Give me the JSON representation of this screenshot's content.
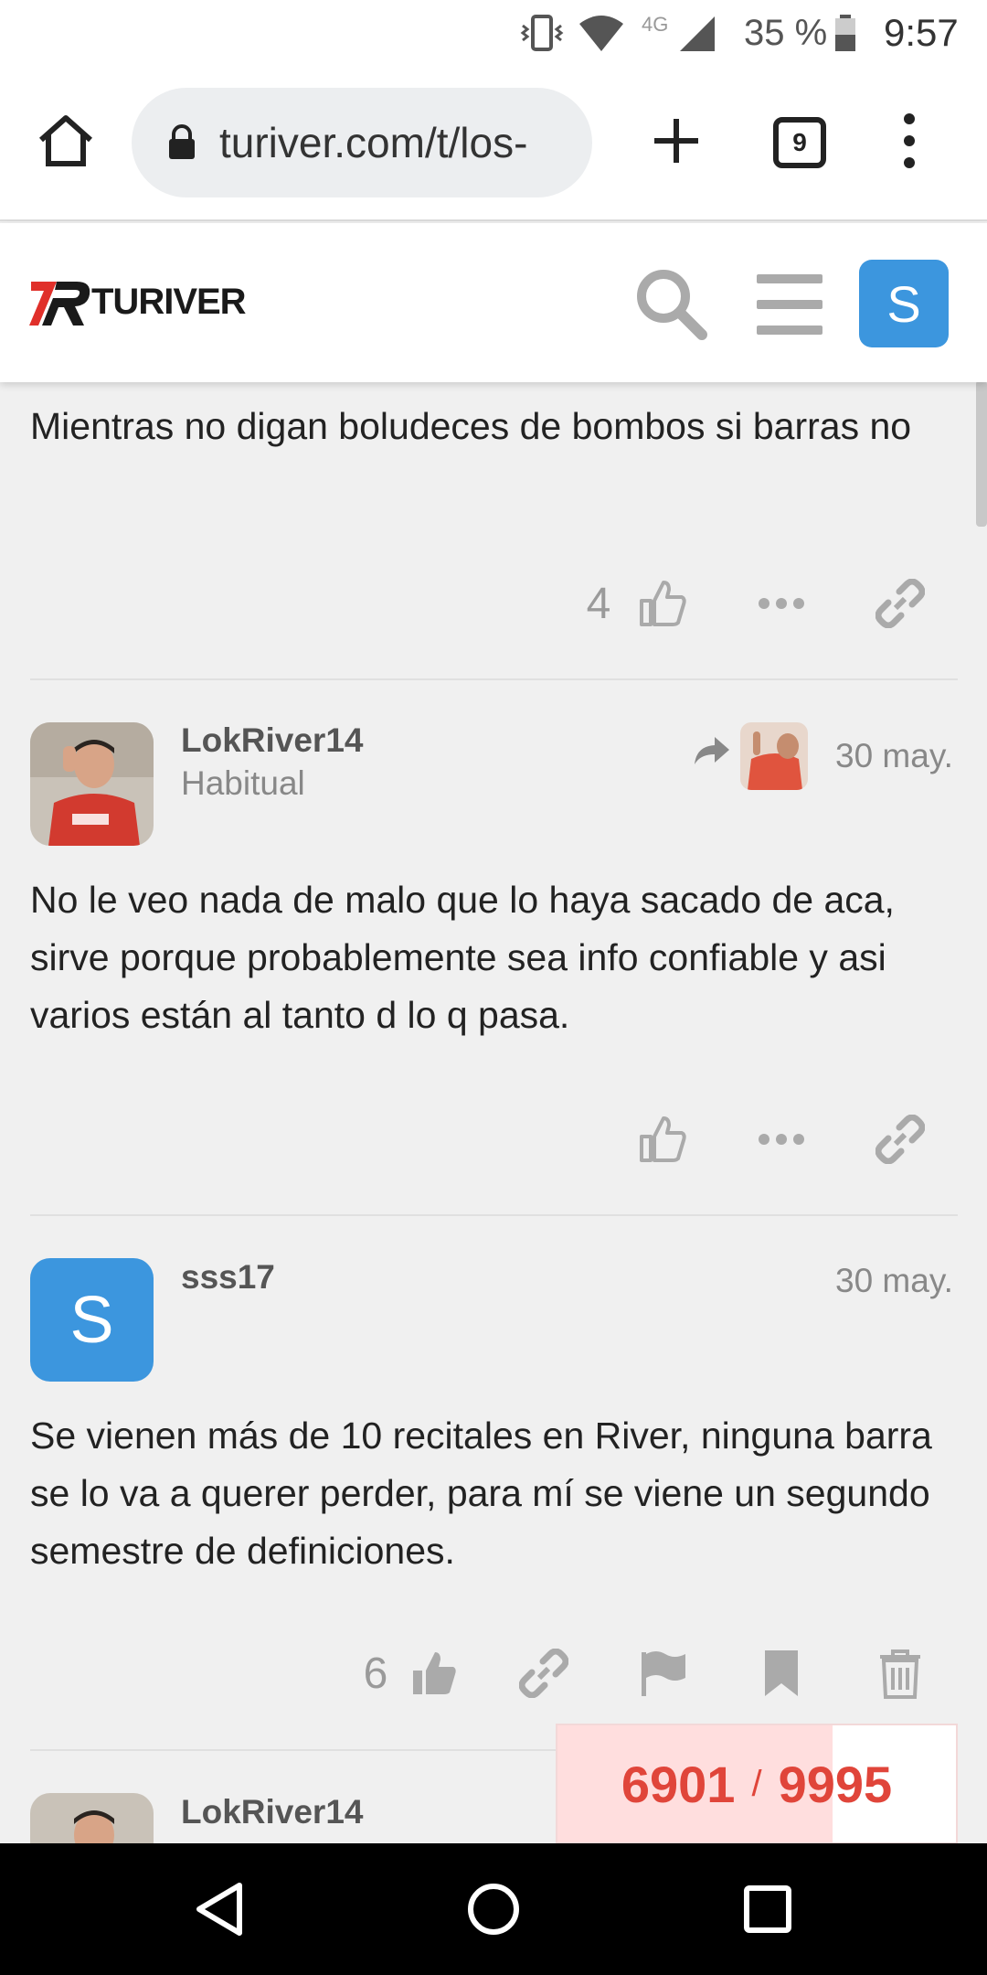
{
  "status_bar": {
    "battery": "35 %",
    "network": "4G",
    "time": "9:57"
  },
  "browser": {
    "url": "turiver.com/t/los-",
    "tab_count": "9"
  },
  "site": {
    "logo_text": "TURIVER",
    "user_avatar_letter": "S"
  },
  "posts": [
    {
      "text": "Mientras no digan boludeces de bombos si barras no",
      "like_count": "4"
    },
    {
      "username": "LokRiver14",
      "user_title": "Habitual",
      "date": "30 may.",
      "text": "No le veo nada de malo que lo haya sacado de aca, sirve porque probablemente sea info confiable y asi varios están al tanto d lo q pasa."
    },
    {
      "username": "sss17",
      "avatar_letter": "S",
      "date": "30 may.",
      "text": "Se vienen más de 10 recitales en River, ninguna barra se lo va a querer perder, para mí se viene un segundo semestre de definiciones.",
      "like_count": "6"
    },
    {
      "username": "LokRiver14"
    }
  ],
  "progress": {
    "current": "6901",
    "separator": "/",
    "total": "9995",
    "fraction": 0.69
  },
  "colors": {
    "accent_blue": "#3c96de",
    "progress_red": "#e0453a",
    "logo_red": "#e0302a"
  }
}
